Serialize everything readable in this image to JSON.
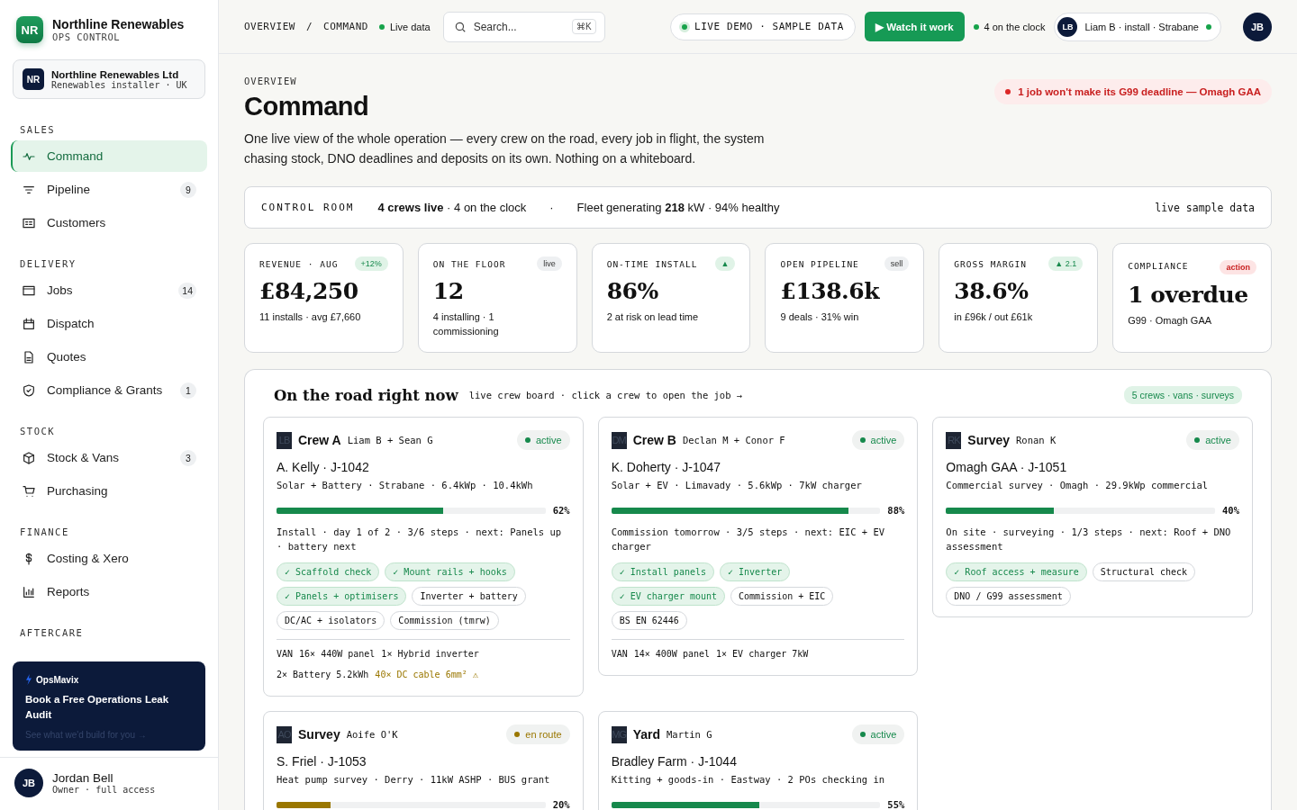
{
  "brand": {
    "logo": "NR",
    "name": "Northline Renewables",
    "subtitle": "OPS CONTROL"
  },
  "org": {
    "logo": "NR",
    "name": "Northline Renewables Ltd",
    "subtitle": "Renewables installer · UK"
  },
  "nav": [
    {
      "heading": "SALES",
      "items": [
        {
          "label": "Command",
          "selected": true
        },
        {
          "label": "Pipeline",
          "count": "9",
          "selected": false
        },
        {
          "label": "Customers",
          "selected": false
        }
      ]
    },
    {
      "heading": "DELIVERY",
      "items": [
        {
          "label": "Jobs",
          "count": "14",
          "selected": false
        },
        {
          "label": "Dispatch",
          "selected": false
        },
        {
          "label": "Quotes",
          "selected": false
        },
        {
          "label": "Compliance & Grants",
          "count": "1",
          "selected": false
        }
      ]
    },
    {
      "heading": "STOCK",
      "items": [
        {
          "label": "Stock & Vans",
          "count": "3",
          "selected": false
        },
        {
          "label": "Purchasing",
          "selected": false
        }
      ]
    },
    {
      "heading": "FINANCE",
      "items": [
        {
          "label": "Costing & Xero",
          "selected": false
        },
        {
          "label": "Reports",
          "selected": false
        }
      ]
    },
    {
      "heading": "AFTERCARE"
    }
  ],
  "promo": {
    "brand": "OpsMavix",
    "title": "Book a Free Operations Leak Audit",
    "link": "See what we'd build for you →"
  },
  "user": {
    "initials": "JB",
    "name": "Jordan Bell",
    "role": "Owner · full access"
  },
  "topbar": {
    "breadcrumb": [
      "OVERVIEW",
      "COMMAND"
    ],
    "separator": "/",
    "live": "Live data",
    "search": {
      "placeholder": "Search...",
      "shortcut": "⌘K"
    },
    "demo_badge": "LIVE DEMO · SAMPLE DATA",
    "watch_button": "▶ Watch it work",
    "clock": "4 on the clock",
    "crew_chip": {
      "initials": "LB",
      "label": "Liam B · install · Strabane"
    },
    "avatar": "JB"
  },
  "page": {
    "eyebrow": "OVERVIEW",
    "title": "Command",
    "intro": "One live view of the whole operation — every crew on the road, every job in flight, the system chasing stock, DNO deadlines and deposits on its own. Nothing on a whiteboard.",
    "alert": "1 job won't make its G99 deadline — Omagh GAA"
  },
  "control_room": {
    "label": "CONTROL ROOM",
    "crews": "4 crews live",
    "clock": "· 4 on the clock",
    "separator": "·",
    "fleet": "Fleet generating",
    "kw": "218",
    "health": "kW · 94% healthy",
    "note": "live sample data"
  },
  "kpis": [
    {
      "label": "REVENUE · AUG",
      "badge": "+12%",
      "kind": "good",
      "value": "£84,250",
      "sub": "11 installs · avg £7,660"
    },
    {
      "label": "ON THE FLOOR",
      "badge": "live",
      "kind": "neutral",
      "value": "12",
      "sub": "4 installing · 1 commissioning"
    },
    {
      "label": "ON-TIME INSTALL",
      "badge": "▲",
      "kind": "good",
      "value": "86%",
      "sub": "2 at risk on lead time"
    },
    {
      "label": "OPEN PIPELINE",
      "badge": "sell",
      "kind": "neutral",
      "value": "£138.6k",
      "sub": "9 deals · 31% win"
    },
    {
      "label": "GROSS MARGIN",
      "badge": "▲ 2.1",
      "kind": "good",
      "value": "38.6%",
      "sub": "in £96k / out £61k"
    },
    {
      "label": "COMPLIANCE",
      "badge": "action",
      "kind": "alert",
      "value": "1 overdue",
      "sub": "G99 · Omagh GAA"
    }
  ],
  "road": {
    "title": "On the road right now",
    "subtitle": "live crew board · click a crew to open the job →",
    "badge": "5 crews · vans · surveys",
    "crews": [
      {
        "initials": "LB",
        "name": "Crew A",
        "members": "Liam B + Sean G",
        "status": "active",
        "color": "#16894c",
        "job": "A. Kelly · J-1042",
        "spec": "Solar + Battery · Strabane · 6.4kWp · 10.4kWh",
        "level": 0.62,
        "percent": "62%",
        "progress": "Install · day 1 of 2 · 3/6 steps · next: Panels up · battery next",
        "steps": [
          {
            "label": "✓ Scaffold check",
            "done": true
          },
          {
            "label": "✓ Mount rails + hooks",
            "done": true
          },
          {
            "label": "✓ Panels + optimisers",
            "done": true
          },
          {
            "label": "Inverter + battery",
            "done": false
          },
          {
            "label": "DC/AC + isolators",
            "done": false
          },
          {
            "label": "Commission (tmrw)",
            "done": false
          }
        ],
        "van": {
          "label": "VAN",
          "items": [
            {
              "text": "16× 440W panel",
              "warn": false
            },
            {
              "text": "1× Hybrid inverter",
              "warn": false
            },
            {
              "text": "2× Battery 5.2kWh",
              "warn": false
            },
            {
              "text": "40× DC cable 6mm² ⚠",
              "warn": true
            }
          ]
        }
      },
      {
        "initials": "DM",
        "name": "Crew B",
        "members": "Declan M + Conor F",
        "status": "active",
        "color": "#16894c",
        "job": "K. Doherty · J-1047",
        "spec": "Solar + EV · Limavady · 5.6kWp · 7kW charger",
        "level": 0.88,
        "percent": "88%",
        "progress": "Commission tomorrow · 3/5 steps · next: EIC + EV charger",
        "steps": [
          {
            "label": "✓ Install panels",
            "done": true
          },
          {
            "label": "✓ Inverter",
            "done": true
          },
          {
            "label": "✓ EV charger mount",
            "done": true
          },
          {
            "label": "Commission + EIC",
            "done": false
          },
          {
            "label": "BS EN 62446",
            "done": false
          }
        ],
        "van": {
          "label": "VAN",
          "items": [
            {
              "text": "14× 400W panel",
              "warn": false
            },
            {
              "text": "1× EV charger 7kW",
              "warn": false
            }
          ]
        }
      },
      {
        "initials": "RK",
        "name": "Survey",
        "members": "Ronan K",
        "status": "active",
        "color": "#16894c",
        "job": "Omagh GAA · J-1051",
        "spec": "Commercial survey · Omagh · 29.9kWp commercial",
        "level": 0.4,
        "percent": "40%",
        "progress": "On site · surveying · 1/3 steps · next: Roof + DNO assessment",
        "steps": [
          {
            "label": "✓ Roof access + measure",
            "done": true
          },
          {
            "label": "Structural check",
            "done": false
          },
          {
            "label": "DNO / G99 assessment",
            "done": false
          }
        ]
      },
      {
        "initials": "AO",
        "name": "Survey",
        "members": "Aoife O'K",
        "status": "en route",
        "color": "#9a7700",
        "job": "S. Friel · J-1053",
        "spec": "Heat pump survey · Derry · 11kW ASHP · BUS grant",
        "level": 0.2,
        "percent": "20%"
      },
      {
        "initials": "MG",
        "name": "Yard",
        "members": "Martin G",
        "status": "active",
        "color": "#16894c",
        "job": "Bradley Farm · J-1044",
        "spec": "Kitting + goods-in · Eastway · 2 POs checking in",
        "level": 0.55,
        "percent": "55%"
      }
    ]
  }
}
